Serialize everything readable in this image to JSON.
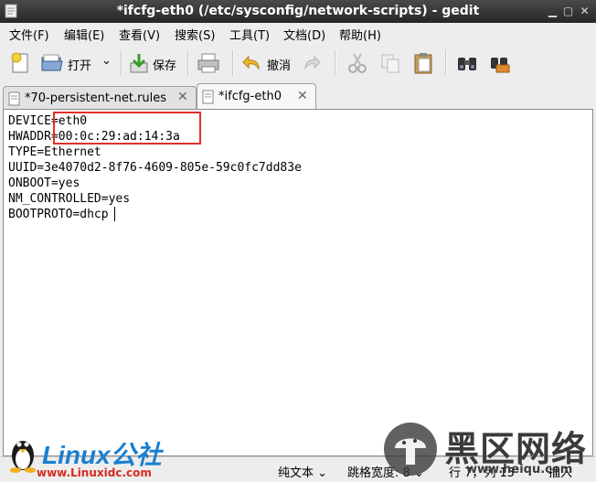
{
  "window": {
    "title": "*ifcfg-eth0 (/etc/sysconfig/network-scripts) - gedit"
  },
  "menu": [
    "文件(F)",
    "编辑(E)",
    "查看(V)",
    "搜索(S)",
    "工具(T)",
    "文档(D)",
    "帮助(H)"
  ],
  "toolbar": {
    "open_label": "打开",
    "save_label": "保存",
    "undo_label": "撤消"
  },
  "tabs": [
    {
      "label": "*70-persistent-net.rules",
      "active": false
    },
    {
      "label": "*ifcfg-eth0",
      "active": true
    }
  ],
  "editor": {
    "lines": [
      "DEVICE=eth0",
      "HWADDR=00:0c:29:ad:14:3a",
      "TYPE=Ethernet",
      "UUID=3e4070d2-8f76-4609-805e-59c0fc7dd83e",
      "ONBOOT=yes",
      "NM_CONTROLLED=yes",
      "BOOTPROTO=dhcp"
    ],
    "highlight_color": "#e0302a"
  },
  "status": {
    "mode": "纯文本",
    "tab_width": "跳格宽度: 8",
    "position": "行 7，列 15",
    "insert": "插入"
  },
  "watermark": {
    "left_text": "Linux公社",
    "left_url": "www.Linuxidc.com",
    "right_text": "黑区网络",
    "right_url": "www.heiqu.com"
  }
}
